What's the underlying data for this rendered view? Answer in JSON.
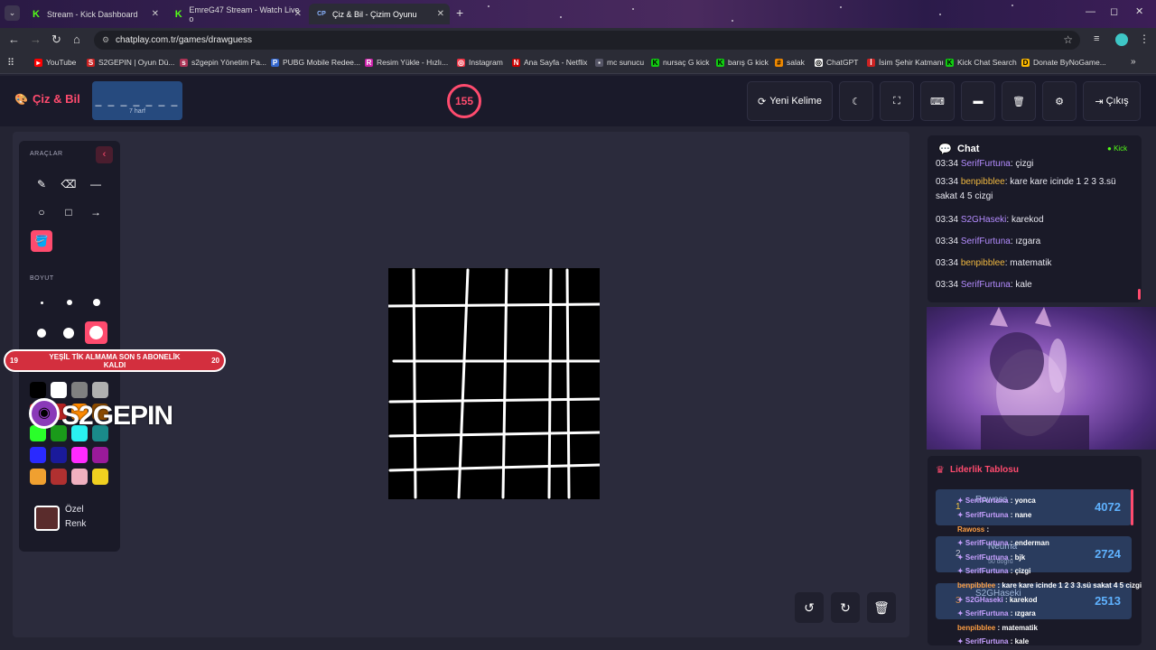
{
  "browser": {
    "tabs": [
      {
        "label": "Stream - Kick Dashboard"
      },
      {
        "label": "EmreG47 Stream - Watch Live o"
      },
      {
        "label": "Çiz & Bil - Çizim Oyunu"
      }
    ],
    "url": "chatplay.com.tr/games/drawguess",
    "bookmarks": [
      "YouTube",
      "S2GEPIN | Oyun Dü...",
      "s2gepin Yönetim Pa...",
      "PUBG Mobile Redee...",
      "Resim Yükle - Hızlı...",
      "Instagram",
      "Ana Sayfa - Netflix",
      "mc sunucu",
      "nursaç G kick",
      "barış G kick",
      "salak",
      "ChatGPT",
      "İsim Şehir Katmanı",
      "Kick Chat Search",
      "Donate ByNoGame..."
    ]
  },
  "header": {
    "brand": "Çiz & Bil",
    "word_mask": "_ _ _ _ _ _ _",
    "letter_count": "7 harf",
    "timer": "155",
    "new_word": "Yeni Kelime",
    "exit": "Çıkış"
  },
  "tools": {
    "section_tools": "ARAÇLAR",
    "section_size": "BOYUT",
    "custom_color_1": "Özel",
    "custom_color_2": "Renk",
    "custom_color": "#5a2c2c",
    "colors": [
      "#000000",
      "#ffffff",
      "#808080",
      "#b0b0b0",
      "#ff2a2a",
      "#b52222",
      "#ff8a00",
      "#8a4a00",
      "#2aff2a",
      "#1a9a1a",
      "#2af0f0",
      "#1a8a8a",
      "#2a2aff",
      "#1a1a9a",
      "#ff2aff",
      "#9a1a9a",
      "#f0a030",
      "#b03030",
      "#f0b0c0",
      "#f0d020"
    ]
  },
  "overlay": {
    "banner_text": "YEŞİL TİK ALMAMA SON 5 ABONELİK KALDI",
    "banner_left": "19",
    "banner_right": "20",
    "logo_text": "S2GEPIN"
  },
  "chat": {
    "title": "Chat",
    "source": "Kick",
    "messages": [
      {
        "time": "03:34",
        "user": "SerifFurtuna",
        "text": "çizgi",
        "color": "#b48cff"
      },
      {
        "time": "03:34",
        "user": "benpibblee",
        "text": "kare kare icinde 1 2 3 3.sü sakat 4 5 cizgi",
        "color": "#f0b840"
      },
      {
        "time": "03:34",
        "user": "S2GHaseki",
        "text": "karekod",
        "color": "#b48cff"
      },
      {
        "time": "03:34",
        "user": "SerifFurtuna",
        "text": "ızgara",
        "color": "#b48cff"
      },
      {
        "time": "03:34",
        "user": "benpibblee",
        "text": "matematik",
        "color": "#f0b840"
      },
      {
        "time": "03:34",
        "user": "SerifFurtuna",
        "text": "kale",
        "color": "#b48cff"
      }
    ]
  },
  "leaderboard": {
    "title": "Liderlik Tablosu",
    "rows": [
      {
        "rank": "1",
        "name": "Rawoss",
        "score": "4072"
      },
      {
        "rank": "2",
        "name": "Neuma",
        "score": "2724"
      },
      {
        "rank": "3",
        "name": "S2GHaseki",
        "score": "2513"
      }
    ],
    "sub2": "50 doğru"
  },
  "stream_overlay_chat": [
    {
      "user": "SerifFurtuna",
      "text": "yonca",
      "type": "u"
    },
    {
      "user": "SerifFurtuna",
      "text": "nane",
      "type": "u"
    },
    {
      "user": "Rawoss",
      "text": "",
      "type": "u2"
    },
    {
      "user": "SerifFurtuna",
      "text": "enderman",
      "type": "u"
    },
    {
      "user": "SerifFurtuna",
      "text": "bjk",
      "type": "u"
    },
    {
      "user": "SerifFurtuna",
      "text": "çizgi",
      "type": "u"
    },
    {
      "user": "benpibblee",
      "text": "kare kare icinde 1 2 3 3.sü sakat 4 5 cizgi",
      "type": "u2"
    },
    {
      "user": "S2GHaseki",
      "text": "karekod",
      "type": "u"
    },
    {
      "user": "SerifFurtuna",
      "text": "ızgara",
      "type": "u"
    },
    {
      "user": "benpibblee",
      "text": "matematik",
      "type": "u2"
    },
    {
      "user": "SerifFurtuna",
      "text": "kale",
      "type": "u"
    }
  ]
}
